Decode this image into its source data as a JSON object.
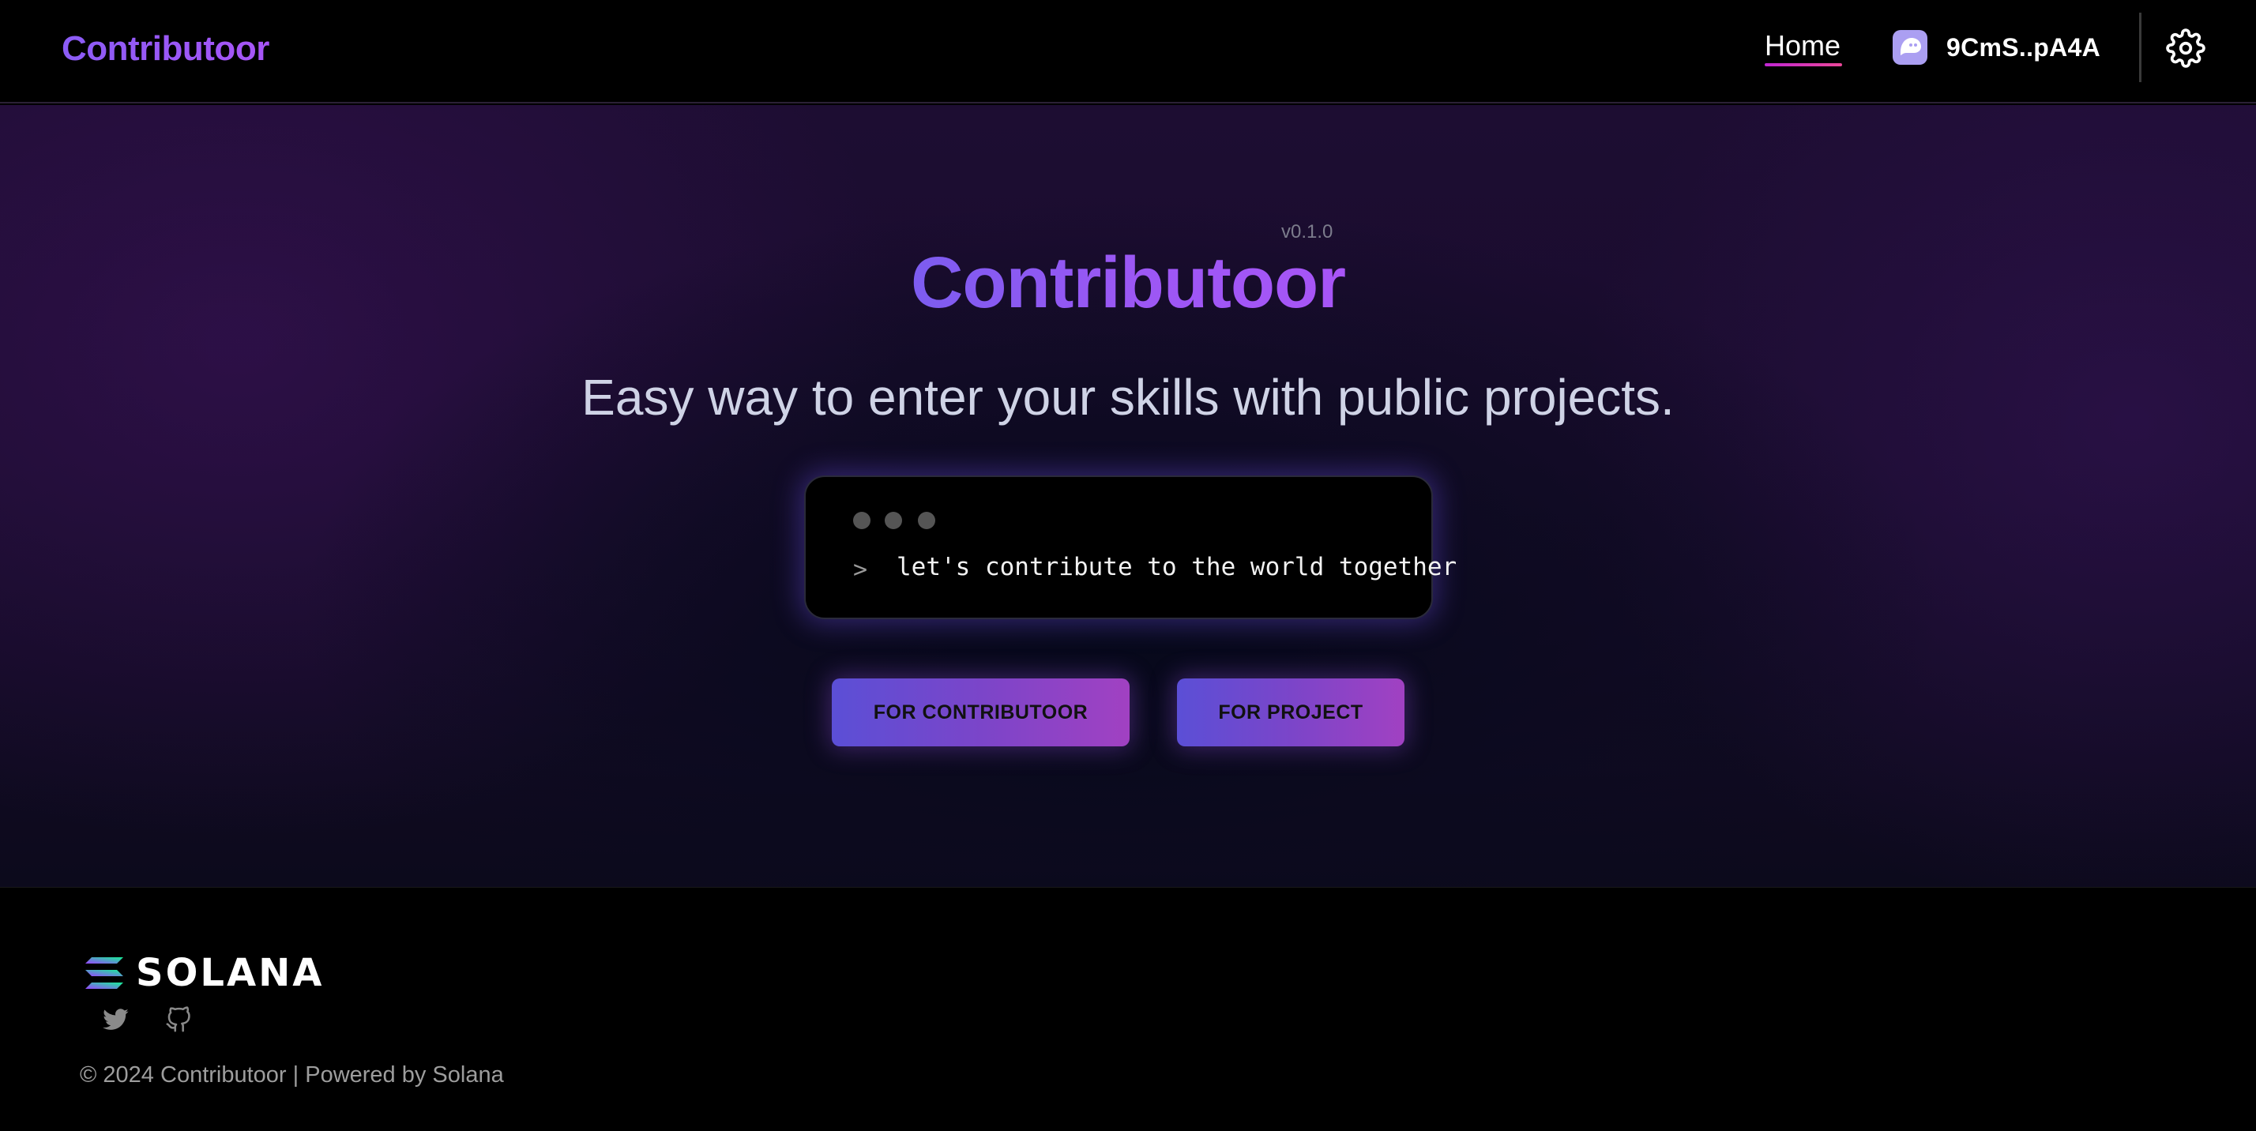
{
  "header": {
    "brand": "Contributoor",
    "nav_home": "Home",
    "wallet_address": "9CmS..pA4A",
    "wallet_icon": "phantom-ghost-icon",
    "settings_icon": "gear-icon"
  },
  "hero": {
    "version": "v0.1.0",
    "title": "Contributoor",
    "subtitle": "Easy way to enter your skills with public projects.",
    "terminal": {
      "prompt": ">",
      "command": "let's contribute to the world together"
    },
    "buttons": {
      "contributoor": "FOR CONTRIBUTOOR",
      "project": "FOR PROJECT"
    }
  },
  "footer": {
    "logo_text": "SOLANA",
    "social": [
      "twitter-icon",
      "github-icon"
    ],
    "copyright": "© 2024 Contributoor | Powered by Solana"
  },
  "colors": {
    "accent": "#9b57f4",
    "button_gradient_start": "#5b4fd6",
    "button_gradient_end": "#a141c2",
    "home_underline": "#ec4899"
  }
}
